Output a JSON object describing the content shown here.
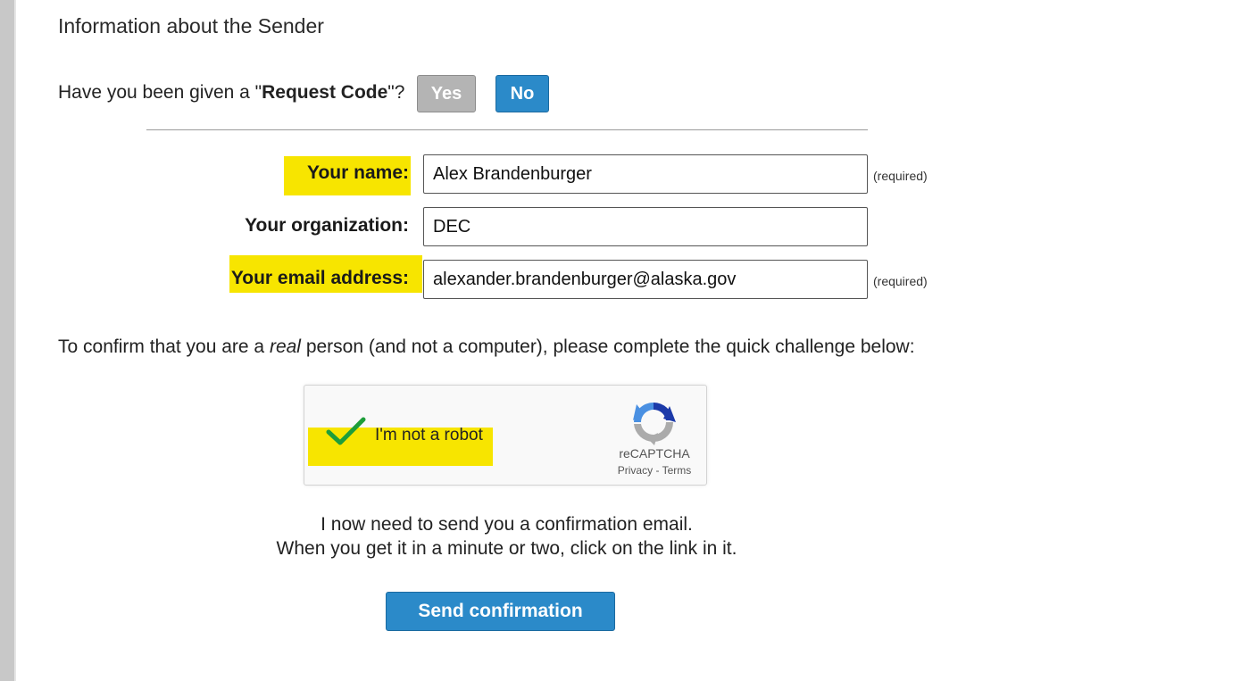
{
  "section": {
    "title": "Information about the Sender"
  },
  "request_code": {
    "prefix": "Have you been given a \"",
    "bold": "Request Code",
    "suffix": "\"?",
    "yes_label": "Yes",
    "no_label": "No"
  },
  "form": {
    "name_label": "Your name:",
    "name_value": "Alex Brandenburger",
    "name_note": "(required)",
    "org_label": "Your organization:",
    "org_value": "DEC",
    "email_label": "Your email address:",
    "email_value": "alexander.brandenburger@alaska.gov",
    "email_note": "(required)"
  },
  "challenge": {
    "prefix": "To confirm that you are a ",
    "italic": "real",
    "suffix": " person (and not a computer), please complete the quick challenge below:"
  },
  "captcha": {
    "label": "I'm not a robot",
    "brand": "reCAPTCHA",
    "privacy": "Privacy",
    "separator": " - ",
    "terms": "Terms",
    "checked": true
  },
  "info": {
    "line1": "I now need to send you a confirmation email.",
    "line2": "When you get it in a minute or two, click on the link in it."
  },
  "actions": {
    "send_label": "Send confirmation"
  },
  "colors": {
    "highlight": "#f7e500",
    "accent_blue": "#2b8ac9",
    "disabled_gray": "#b4b4b4",
    "check_green": "#1e9e3a"
  }
}
